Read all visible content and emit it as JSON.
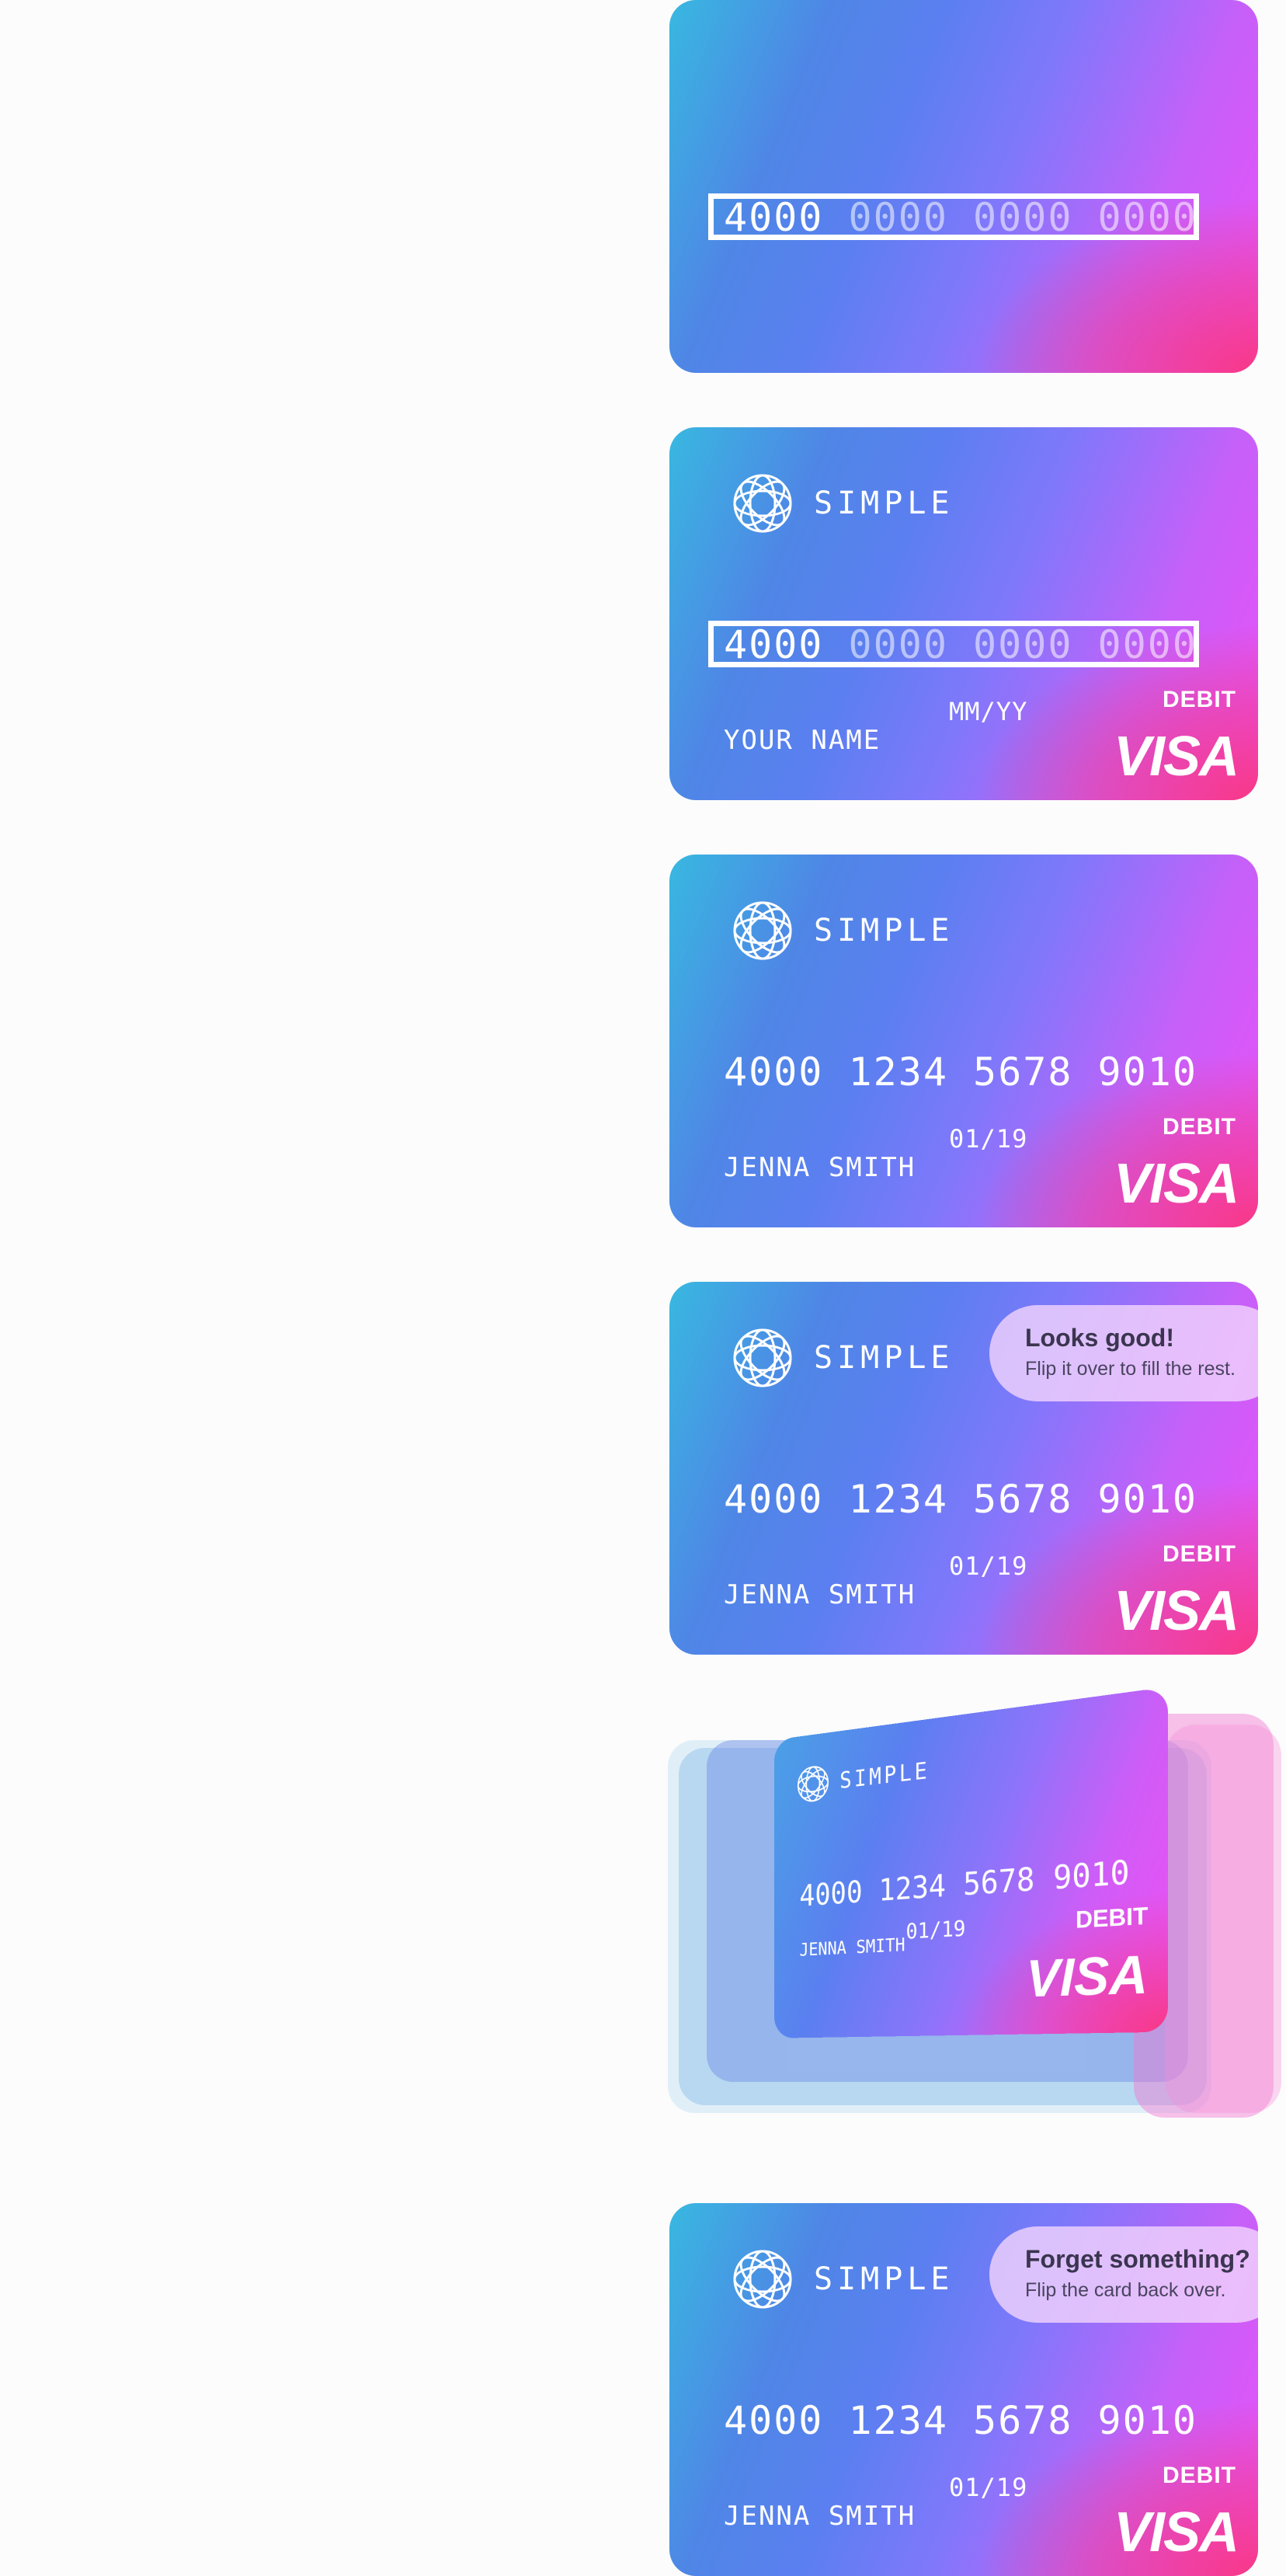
{
  "brand": {
    "name": "SIMPLE"
  },
  "card_states": [
    {
      "number_entered": "4000",
      "number_placeholder": "0000 0000 0000"
    },
    {
      "number_entered": "4000",
      "number_placeholder": "0000 0000 0000",
      "name": "YOUR NAME",
      "expiry": "MM/YY",
      "type": "DEBIT",
      "network": "VISA"
    },
    {
      "number": "4000 1234 5678 9010",
      "name": "JENNA SMITH",
      "expiry": "01/19",
      "type": "DEBIT",
      "network": "VISA"
    },
    {
      "number": "4000 1234 5678 9010",
      "name": "JENNA SMITH",
      "expiry": "01/19",
      "type": "DEBIT",
      "network": "VISA",
      "bubble": {
        "title": "Looks good!",
        "subtitle": "Flip it over to fill the rest."
      }
    },
    {
      "number": "4000 1234 5678 9010",
      "name": "JENNA SMITH",
      "expiry": "01/19",
      "type": "DEBIT",
      "network": "VISA"
    },
    {
      "number": "4000 1234 5678 9010",
      "name": "JENNA SMITH",
      "expiry": "01/19",
      "type": "DEBIT",
      "network": "VISA",
      "bubble": {
        "title": "Forget something?",
        "subtitle": "Flip the card back over."
      }
    }
  ],
  "colors": {
    "gradient_start": "#38b8e0",
    "gradient_mid": "#7f78fb",
    "gradient_end": "#ec4ff6",
    "accent_pink": "#f83782"
  }
}
